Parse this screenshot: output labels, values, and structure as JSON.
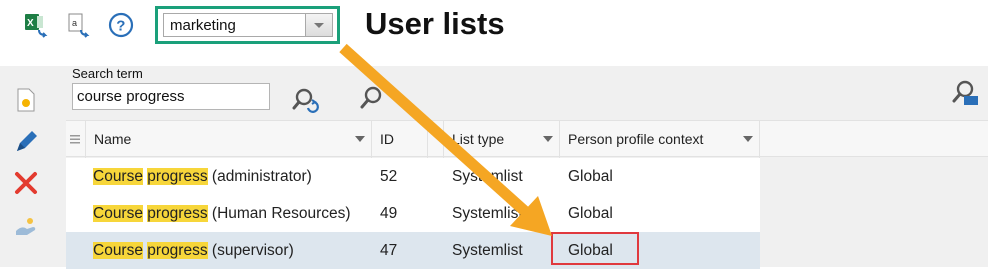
{
  "header": {
    "title": "User lists",
    "context_select": {
      "value": "marketing"
    }
  },
  "search": {
    "label": "Search term",
    "value": "course progress"
  },
  "table": {
    "columns": [
      {
        "label": "Name"
      },
      {
        "label": "ID"
      },
      {
        "label": "List type"
      },
      {
        "label": "Person profile context"
      }
    ],
    "highlight_words": [
      "Course",
      "progress"
    ],
    "rows": [
      {
        "name_w1": "Course",
        "name_w2": "progress",
        "name_rest": "(administrator)",
        "id": "52",
        "list_type": "Systemlist",
        "context": "Global",
        "selected": false
      },
      {
        "name_w1": "Course",
        "name_w2": "progress",
        "name_rest": "(Human Resources)",
        "id": "49",
        "list_type": "Systemlist",
        "context": "Global",
        "selected": false
      },
      {
        "name_w1": "Course",
        "name_w2": "progress",
        "name_rest": "(supervisor)",
        "id": "47",
        "list_type": "Systemlist",
        "context": "Global",
        "selected": true
      }
    ]
  },
  "colors": {
    "select_frame": "#1aa07a",
    "highlight": "#f7d63a",
    "arrow": "#f5a623",
    "callout_box": "#e0393e",
    "selected_row": "#dde6ee"
  },
  "icons": {
    "export_excel": "excel-export-icon",
    "export_text": "text-export-icon",
    "help": "help-icon",
    "new": "new-list-icon",
    "edit": "pencil-icon",
    "delete": "delete-icon",
    "assign": "assign-hand-icon",
    "reset_search": "reset-search-icon",
    "search": "search-icon",
    "layout": "layout-person-icon"
  }
}
